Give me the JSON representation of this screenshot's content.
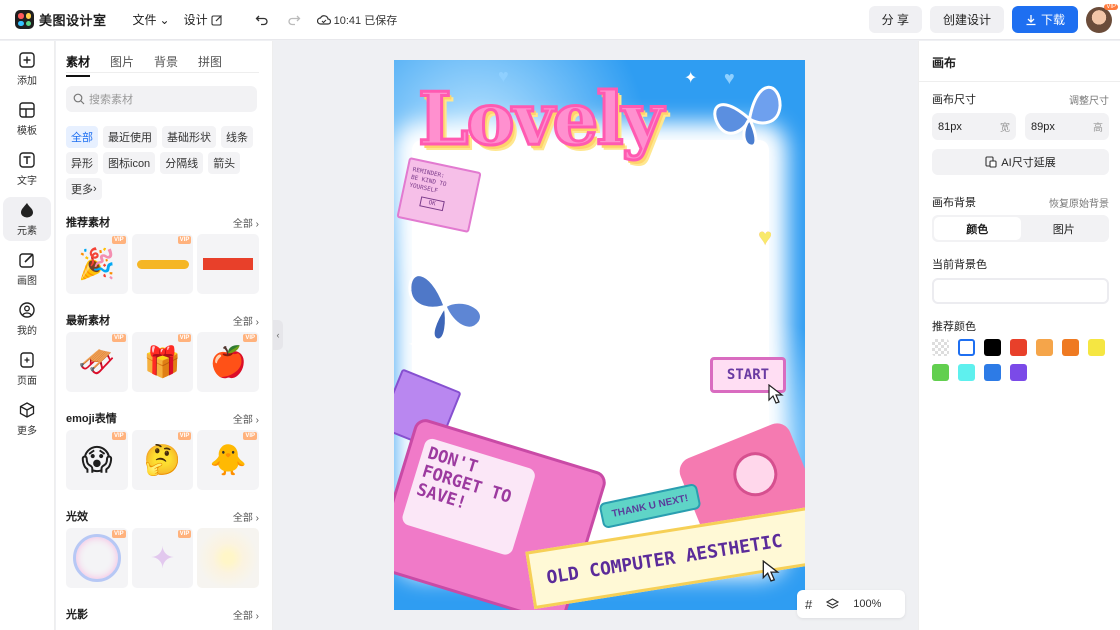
{
  "app": {
    "name": "美图设计室"
  },
  "header": {
    "file_menu": "文件",
    "design_menu": "设计",
    "save_status": "10:41 已保存",
    "share": "分 享",
    "create": "创建设计",
    "download": "下载",
    "vip_badge": "VIP"
  },
  "rail": [
    {
      "label": "添加"
    },
    {
      "label": "模板"
    },
    {
      "label": "文字"
    },
    {
      "label": "元素"
    },
    {
      "label": "画图"
    },
    {
      "label": "我的"
    },
    {
      "label": "页面"
    },
    {
      "label": "更多"
    }
  ],
  "panel": {
    "tabs": [
      "素材",
      "图片",
      "背景",
      "拼图"
    ],
    "search_placeholder": "搜索素材",
    "chips": [
      "全部",
      "最近使用",
      "基础形状",
      "线条",
      "异形",
      "图标icon",
      "分隔线",
      "箭头",
      "更多"
    ],
    "sections": [
      {
        "title": "推荐素材",
        "all": "全部"
      },
      {
        "title": "最新素材",
        "all": "全部"
      },
      {
        "title": "emoji表情",
        "all": "全部"
      },
      {
        "title": "光效",
        "all": "全部"
      },
      {
        "title": "光影",
        "all": "全部"
      }
    ],
    "vip": "VIP"
  },
  "canvas": {
    "title_text": "Lovely",
    "popup_line1": "REMINDER:",
    "popup_line2": "BE KIND TO YOURSELF",
    "popup_ok": "OK",
    "start": "START",
    "thank": "THANK U NEXT!",
    "tv_text": "DON'T FORGET TO SAVE!",
    "banner": "OLD COMPUTER AESTHETIC"
  },
  "zoom": {
    "level": "100%"
  },
  "right": {
    "title": "画布",
    "size_label": "画布尺寸",
    "size_action": "调整尺寸",
    "width_value": "81px",
    "width_unit": "宽",
    "height_value": "89px",
    "height_unit": "高",
    "ai_btn": "AI尺寸延展",
    "bg_label": "画布背景",
    "bg_action": "恢复原始背景",
    "seg_color": "颜色",
    "seg_image": "图片",
    "current_bg": "当前背景色",
    "recommend": "推荐颜色",
    "swatches": [
      "transparent",
      "#ffffff",
      "#000000",
      "#e8402a",
      "#f5a54a",
      "#ef7a22",
      "#f5e642",
      "#62cf4f",
      "#5ef0ee",
      "#2d7be6",
      "#7b4ae8"
    ]
  }
}
